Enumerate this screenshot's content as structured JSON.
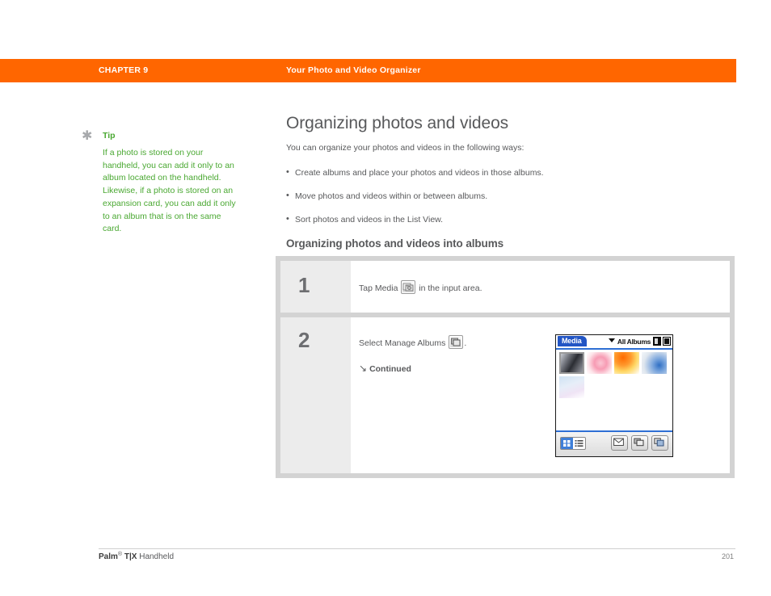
{
  "header": {
    "chapter_label": "CHAPTER 9",
    "chapter_title": "Your Photo and Video Organizer",
    "bar_color": "#ff6600"
  },
  "tip": {
    "icon": "asterisk-icon",
    "label": "Tip",
    "body": "If a photo is stored on your handheld, you can add it only to an album located on the handheld. Likewise, if a photo is stored on an expansion card, you can add it only to an album that is on the same card.",
    "text_color": "#4aa832"
  },
  "main": {
    "title": "Organizing photos and videos",
    "intro": "You can organize your photos and videos in the following ways:",
    "bullets": [
      "Create albums and place your photos and videos in those albums.",
      "Move photos and videos within or between albums.",
      "Sort photos and videos in the List View."
    ],
    "subtitle": "Organizing photos and videos into albums"
  },
  "steps": [
    {
      "number": "1",
      "text_before": "Tap Media",
      "icon": "media-app-icon",
      "text_after": "in the input area."
    },
    {
      "number": "2",
      "text_before": "Select Manage Albums",
      "icon": "manage-albums-icon",
      "text_after": ".",
      "continued_arrow": "↘",
      "continued": "Continued"
    }
  ],
  "pda_screenshot": {
    "app_tab": "Media",
    "album_selector": "All Albums",
    "selector_icon": "caret-down-icon",
    "system_icons": [
      "battery-icon",
      "bluetooth-icon"
    ],
    "thumbnails": [
      {
        "name": "video-thumbnail",
        "selected": true,
        "colors": [
          "#b9bcc2",
          "#3a3d44",
          "#8d9098"
        ]
      },
      {
        "name": "pink-rose-photo",
        "selected": false,
        "colors": [
          "#fde3e8",
          "#f7a8bd",
          "#fbd2dc"
        ]
      },
      {
        "name": "orange-abstract-photo",
        "selected": false,
        "colors": [
          "#ff7a18",
          "#ffd24a",
          "#ffffff"
        ]
      },
      {
        "name": "blue-bubbles-photo",
        "selected": false,
        "colors": [
          "#dfe6ee",
          "#2f6fc4",
          "#9fc1e8"
        ]
      },
      {
        "name": "pastel-sky-photo",
        "selected": false,
        "colors": [
          "#cfe2f3",
          "#e8dff3",
          "#ffffff"
        ]
      }
    ],
    "view_toggle": {
      "grid_icon": "grid-view-icon",
      "list_icon": "list-view-icon",
      "active": "grid"
    },
    "tool_buttons": [
      {
        "name": "send-email-icon"
      },
      {
        "name": "manage-albums-icon"
      },
      {
        "name": "copy-icon"
      }
    ],
    "accent_color": "#2255c4"
  },
  "footer": {
    "brand": "Palm",
    "registered": "®",
    "model": "T|X",
    "product": " Handheld",
    "page_number": "201"
  }
}
